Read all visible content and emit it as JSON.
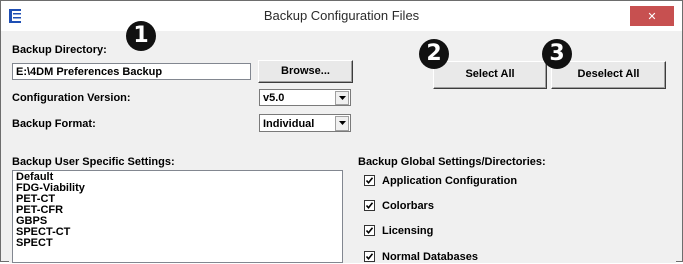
{
  "window": {
    "title": "Backup Configuration Files",
    "close_glyph": "✕",
    "icon": "app-logo-icon",
    "accent_color": "#1f4fb4",
    "close_color": "#c75050"
  },
  "backup_directory": {
    "label": "Backup Directory:",
    "value": "E:\\4DM Preferences Backup",
    "browse_label": "Browse..."
  },
  "configuration_version": {
    "label": "Configuration Version:",
    "selected": "v5.0"
  },
  "backup_format": {
    "label": "Backup Format:",
    "selected": "Individual"
  },
  "selection_buttons": {
    "select_all": "Select All",
    "deselect_all": "Deselect All"
  },
  "user_settings": {
    "label": "Backup User Specific Settings:",
    "items": [
      {
        "label": "Default"
      },
      {
        "label": "FDG-Viability"
      },
      {
        "label": "PET-CT"
      },
      {
        "label": "PET-CFR"
      },
      {
        "label": "GBPS"
      },
      {
        "label": "SPECT-CT"
      },
      {
        "label": "SPECT"
      }
    ]
  },
  "global_settings": {
    "label": "Backup Global Settings/Directories:",
    "items": [
      {
        "label": "Application Configuration",
        "checked": true
      },
      {
        "label": "Colorbars",
        "checked": true
      },
      {
        "label": "Licensing",
        "checked": true
      },
      {
        "label": "Normal Databases",
        "checked": true
      }
    ]
  },
  "callouts": {
    "one": "1",
    "two": "2",
    "three": "3"
  }
}
